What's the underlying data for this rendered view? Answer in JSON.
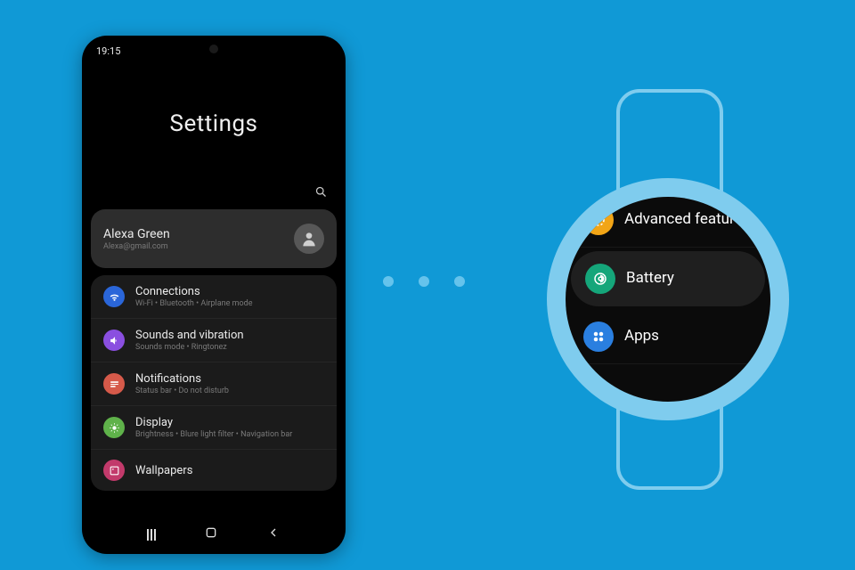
{
  "colors": {
    "background": "#1099d6",
    "accent_light": "#7fccee",
    "dot": "#65c3ec"
  },
  "phone": {
    "status": {
      "time": "19:15"
    },
    "title": "Settings",
    "account": {
      "name": "Alexa Green",
      "email": "Alexa@gmail.com"
    },
    "groups": [
      {
        "items": [
          {
            "icon": "wifi-icon",
            "color": "#2a66d9",
            "title": "Connections",
            "subtitle": "Wi-Fi  •  Bluetooth  •  Airplane mode"
          },
          {
            "icon": "sound-icon",
            "color": "#8a4fe0",
            "title": "Sounds and vibration",
            "subtitle": "Sounds mode  •  Ringtonez"
          },
          {
            "icon": "notification-icon",
            "color": "#d65a4a",
            "title": "Notifications",
            "subtitle": "Status bar  •  Do not disturb"
          },
          {
            "icon": "display-icon",
            "color": "#5fb24a",
            "title": "Display",
            "subtitle": "Brightness  •  Blure light filter  •  Navigation bar"
          },
          {
            "icon": "wallpaper-icon",
            "color": "#c23a6b",
            "title": "Wallpapers",
            "subtitle": ""
          }
        ]
      }
    ]
  },
  "watch": {
    "items": [
      {
        "icon": "gear-plus-icon",
        "color": "#f2a516",
        "title": "Advanced features",
        "selected": false
      },
      {
        "icon": "battery-icon",
        "color": "#15a67a",
        "title": "Battery",
        "selected": true
      },
      {
        "icon": "apps-icon",
        "color": "#2a7fe0",
        "title": "Apps",
        "selected": false
      }
    ]
  }
}
